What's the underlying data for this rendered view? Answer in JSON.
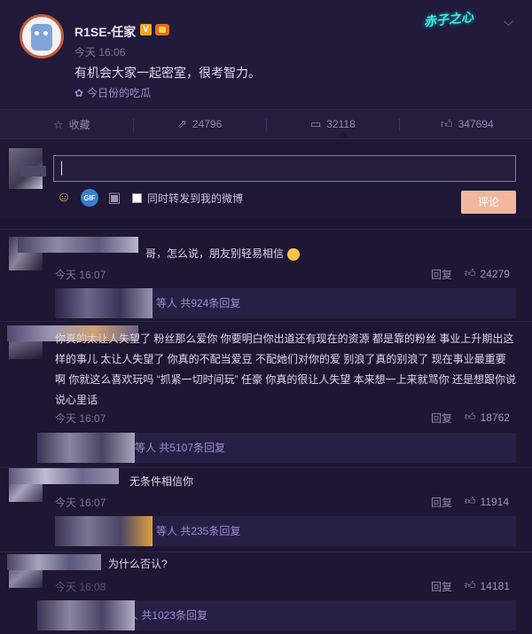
{
  "post": {
    "username": "R1SE-任家",
    "verified_badge": "V",
    "time": "今天 16:06",
    "text": "有机会大家一起密室，很考智力。",
    "topic_icon": "flower-icon",
    "topic": "今日份的吃瓜",
    "brand_logo_text": "赤子之心"
  },
  "actions": [
    {
      "icon": "star-icon",
      "label": "收藏"
    },
    {
      "icon": "share-icon",
      "label": "24796"
    },
    {
      "icon": "comment-icon",
      "label": "32118"
    },
    {
      "icon": "thumbs-up-icon",
      "label": "347694"
    }
  ],
  "composer": {
    "input_value": "",
    "forward_label": "同时转发到我的微博",
    "submit_label": "评论",
    "gif_label": "GIF"
  },
  "comments": [
    {
      "text": "哥，怎么说，朋友别轻易相信",
      "time": "今天 16:07",
      "reply": "回复",
      "likes": "24279",
      "sub": "等人 共924条回复"
    },
    {
      "text": "你真的太让人失望了 粉丝那么爱你 你要明白你出道还有现在的资源 都是靠的粉丝 事业上升期出这样的事儿 太让人失望了 你真的不配当爱豆 不配她们对你的爱 别浪了真的别浪了 现在事业最重要啊 你就这么喜欢玩吗 “抓紧一切时间玩” 任豪 你真的很让人失望 本来想一上来就骂你 还是想跟你说说心里话",
      "time": "今天 16:07",
      "reply": "回复",
      "likes": "18762",
      "sub": "等人 共5107条回复"
    },
    {
      "text": "无条件相信你",
      "time": "今天 16:07",
      "reply": "回复",
      "likes": "11914",
      "sub": "等人 共235条回复"
    },
    {
      "text": "为什么否认?",
      "time": "今天 16:08",
      "reply": "回复",
      "likes": "14181",
      "sub": "等人 共1023条回复"
    }
  ],
  "colors": {
    "background": "#1a1530",
    "accent": "#f2b79d",
    "link": "#9b8ed0"
  }
}
